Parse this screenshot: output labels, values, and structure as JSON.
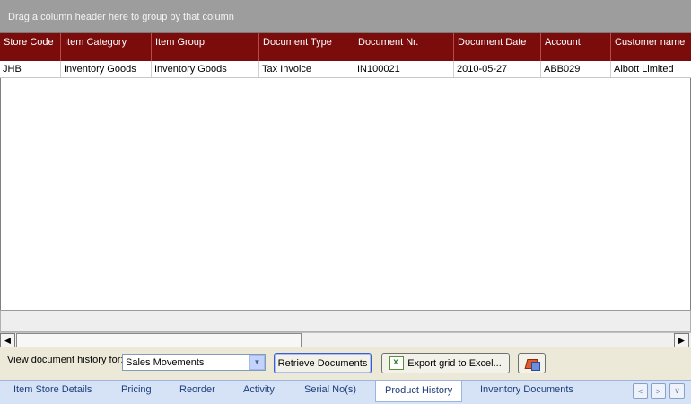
{
  "group_panel": {
    "text": "Drag a column header here to group by that column"
  },
  "grid": {
    "columns": [
      "Store Code",
      "Item Category",
      "Item Group",
      "Document Type",
      "Document Nr.",
      "Document Date",
      "Account",
      "Customer name"
    ],
    "rows": [
      [
        "JHB",
        "Inventory Goods",
        "Inventory Goods",
        "Tax Invoice",
        "IN100021",
        "2010-05-27",
        "ABB029",
        "Albott Limited"
      ]
    ]
  },
  "toolbar": {
    "history_label": "View document history for:",
    "history_value": "Sales Movements",
    "retrieve_label": "Retrieve Documents",
    "export_label": "Export grid to Excel..."
  },
  "tabs": [
    {
      "label": "Item Store Details"
    },
    {
      "label": "Pricing"
    },
    {
      "label": "Reorder"
    },
    {
      "label": "Activity"
    },
    {
      "label": "Serial No(s)"
    },
    {
      "label": "Product History"
    },
    {
      "label": "Inventory Documents"
    }
  ],
  "icons": {
    "scroll_left": "◀",
    "scroll_right": "▶",
    "dropdown": "▼",
    "nav_prev": "<",
    "nav_next": ">",
    "nav_menu": "∨"
  }
}
